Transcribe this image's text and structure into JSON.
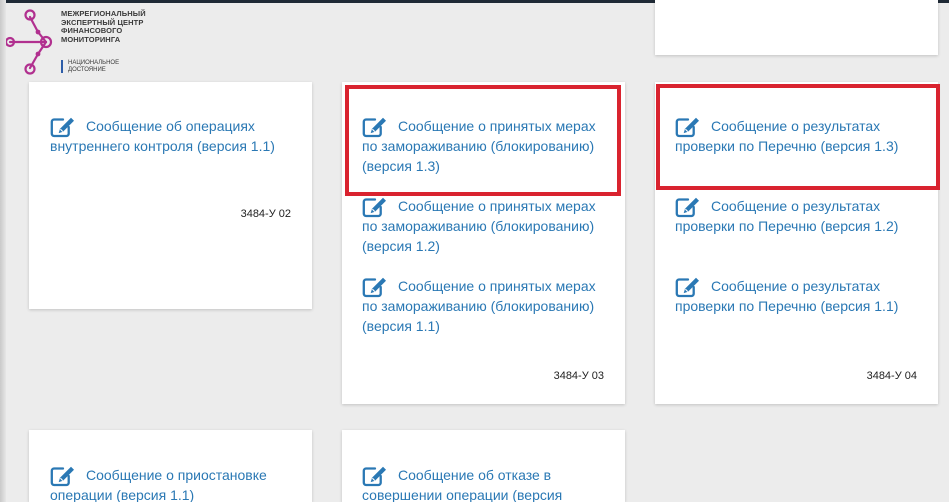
{
  "logo": {
    "lines": [
      "МЕЖРЕГИОНАЛЬНЫЙ",
      "ЭКСПЕРТНЫЙ ЦЕНТР",
      "ФИНАНСОВОГО",
      "МОНИТОРИНГА"
    ],
    "sub": [
      "НАЦИОНАЛЬНОЕ",
      "ДОСТОЯНИЕ"
    ],
    "icon": "network-node-logo",
    "colors": {
      "accent": "#b1308f",
      "bar": "#2e5da8"
    }
  },
  "cards": [
    {
      "items": [
        "Сообщение об операциях внутреннего контроля (версия 1.1)"
      ],
      "code": "3484-У 02"
    },
    {
      "items": [
        "Сообщение о принятых мерах по замораживанию (блокированию) (версия 1.3)",
        "Сообщение о принятых мерах по замораживанию (блокированию) (версия 1.2)",
        "Сообщение о принятых мерах по замораживанию (блокированию) (версия 1.1)"
      ],
      "code": "3484-У 03"
    },
    {
      "items": [
        "Сообщение о результатах проверки по Перечню (версия 1.3)",
        "Сообщение о результатах проверки по Перечню (версия 1.2)",
        "Сообщение о результатах проверки по Перечню (версия 1.1)"
      ],
      "code": "3484-У 04"
    },
    {
      "items": [
        "Сообщение о приостановке операции (версия 1.1)"
      ]
    },
    {
      "items": [
        "Сообщение об отказе в совершении операции (версия"
      ]
    }
  ],
  "icon_name": "edit-icon",
  "colors": {
    "link": "#2a78b4",
    "highlight": "#d9232f",
    "page_bg": "#ececec",
    "card_bg": "#ffffff"
  }
}
